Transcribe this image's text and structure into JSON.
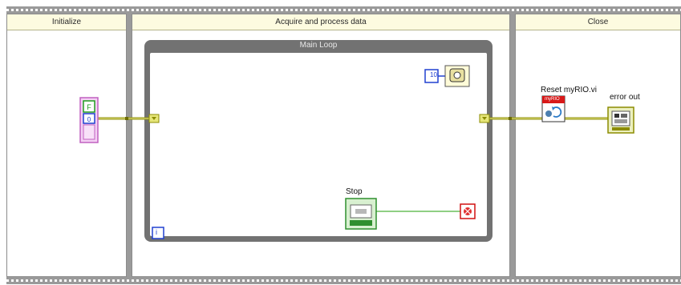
{
  "frames": [
    {
      "title": "Initialize"
    },
    {
      "title": "Acquire and process data"
    },
    {
      "title": "Close"
    }
  ],
  "loop": {
    "title": "Main Loop",
    "iteration_label": "i",
    "wait_constant": "10"
  },
  "nodes": {
    "stop_label": "Stop",
    "reset_label": "Reset myRIO.vi",
    "reset_banner": "myRIO",
    "error_out_label": "error out"
  },
  "colors": {
    "error_wire": "#8c8c00",
    "bool_wire": "#6abf5a",
    "frame_header": "#fdfbe0",
    "loop_border": "#727272"
  }
}
